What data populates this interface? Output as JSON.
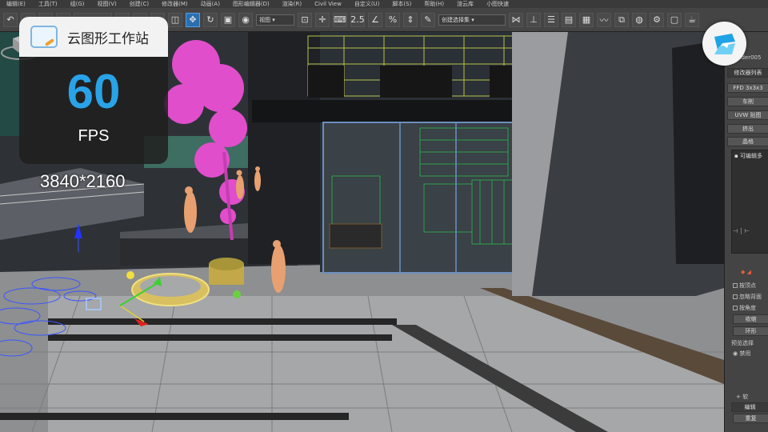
{
  "menubar": {
    "items": [
      "编辑(E)",
      "工具(T)",
      "组(G)",
      "视图(V)",
      "创建(C)",
      "修改器(M)",
      "动画(A)",
      "图形编辑器(D)",
      "渲染(R)",
      "Civil View",
      "自定义(U)",
      "脚本(S)",
      "帮助(H)",
      "渲云库",
      "小图快速"
    ]
  },
  "toolbar": {
    "view_select": "视图",
    "selection_set": "创建选择集"
  },
  "overlay": {
    "brand_title": "云图形工作站",
    "fps_value": "60",
    "fps_unit": "FPS",
    "resolution": "3840*2160"
  },
  "command_panel": {
    "object_name": "ylinder005",
    "modifier_list": "修改器列表",
    "buttons": [
      "FFD 3x3x3",
      "车削",
      "UVW 贴图",
      "挤出",
      "晶格"
    ],
    "stack_item": "可编辑多",
    "checkboxes": [
      "按顶点",
      "忽略背面",
      "按角度"
    ],
    "shrink_label": "收缩",
    "ring_label": "环形",
    "preview_label": "预览选择",
    "disable_label": "禁用",
    "soft_label": "软",
    "edit_label": "编辑",
    "repeat_label": "重复"
  }
}
